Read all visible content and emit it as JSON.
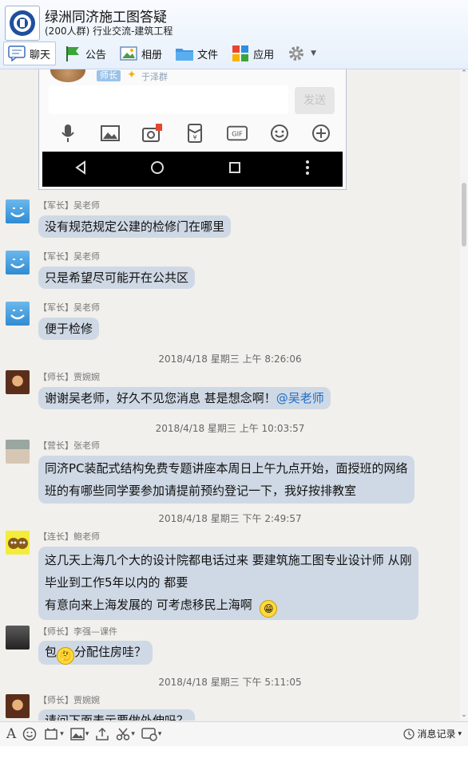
{
  "header": {
    "title": "绿洲同济施工图答疑",
    "subtitle": "(200人群) 行业交流-建筑工程",
    "tabs": [
      {
        "label": "聊天",
        "icon": "chat-icon"
      },
      {
        "label": "公告",
        "icon": "announcement-flag-icon"
      },
      {
        "label": "相册",
        "icon": "album-icon"
      },
      {
        "label": "文件",
        "icon": "folder-icon"
      },
      {
        "label": "应用",
        "icon": "apps-icon"
      }
    ]
  },
  "embedded_screenshot": {
    "role_tag": "师长",
    "name": "于泽群",
    "send_label": "发送"
  },
  "messages": [
    {
      "role": "【军长】",
      "name": "吴老师",
      "avatar": "smile",
      "lines": [
        "没有规范规定公建的检修门在哪里"
      ]
    },
    {
      "role": "【军长】",
      "name": "吴老师",
      "avatar": "smile",
      "lines": [
        "只是希望尽可能开在公共区"
      ]
    },
    {
      "role": "【军长】",
      "name": "吴老师",
      "avatar": "smile",
      "lines": [
        "便于检修"
      ]
    },
    {
      "timestamp": "2018/4/18 星期三 上午 8:26:06"
    },
    {
      "role": "【师长】",
      "name": "贾婉婉",
      "avatar": "girl",
      "text": "谢谢吴老师，好久不见您消息 甚是想念啊！",
      "mention": "@吴老师"
    },
    {
      "timestamp": "2018/4/18 星期三 上午 10:03:57"
    },
    {
      "role": "【营长】",
      "name": "张老师",
      "avatar": "land",
      "lines": [
        "同济PC装配式结构免费专题讲座本周日上午九点开始，面授班的网络",
        "班的有哪些同学要参加请提前预约登记一下，我好按排教室"
      ]
    },
    {
      "timestamp": "2018/4/18 星期三 下午 2:49:57"
    },
    {
      "role": "【连长】",
      "name": "鲍老师",
      "avatar": "yellow",
      "lines": [
        "这几天上海几个大的设计院都电话过来 要建筑施工图专业设计师  从刚",
        "毕业到工作5年以内的  都要",
        "有意向来上海发展的  可考虑移民上海啊"
      ]
    },
    {
      "role": "【师长】",
      "name": "李强—课件",
      "avatar": "dark",
      "text_before": "包",
      "text_after": "分配住房哇？"
    },
    {
      "timestamp": "2018/4/18 星期三 下午 5:11:05"
    },
    {
      "role": "【师长】",
      "name": "贾婉婉",
      "avatar": "girl",
      "lines": [
        "请问下面表示要做外伸吗？"
      ]
    }
  ],
  "bottom_toolbar": {
    "history_label": "消息记录",
    "font_label": "A"
  },
  "colors": {
    "bubble": "#cfd9e5",
    "mention": "#1d6dc7",
    "header_bg": "#e7f0fb"
  }
}
